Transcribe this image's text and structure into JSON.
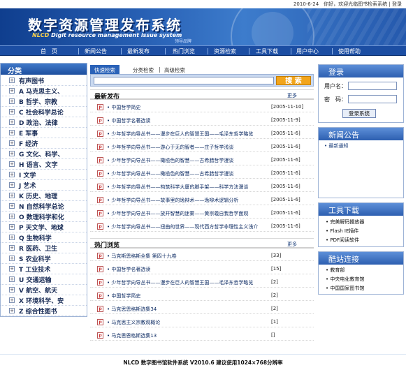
{
  "topbar": {
    "text": "2010-6-24　你好，欢迎光临图书检索系统 | 登录"
  },
  "banner": {
    "title": "数字资源管理发布系统",
    "sub_brand": "NLCD",
    "sub_text": "Digit resource management issue system",
    "small": "领导品牌"
  },
  "nav": {
    "items": [
      "首　页",
      "新闻公告",
      "最新发布",
      "热门浏览",
      "资源检索",
      "工具下载",
      "用户中心",
      "使用帮助"
    ]
  },
  "sidebar": {
    "title": "分类",
    "items": [
      "有声图书",
      "A 马克思主义、",
      "B 哲学、宗教",
      "C 社会科学总论",
      "D 政治、法律",
      "E 军事",
      "F 经济",
      "G 文化、科学、",
      "H 语言、文字",
      "I 文学",
      "J 艺术",
      "K 历史、地理",
      "N 自然科学总论",
      "O 数理科学和化",
      "P 天文学、地球",
      "Q 生物科学",
      "R 医药、卫生",
      "S 农业科学",
      "T 工业技术",
      "U 交通运输",
      "V 航空、航天",
      "X 环境科学、安",
      "Z 综合性图书"
    ]
  },
  "search": {
    "tabs": [
      "快速检索",
      "分类检索",
      "高级检索"
    ],
    "button": "搜 索",
    "value": ""
  },
  "latest": {
    "title": "最新发布",
    "more": "更多",
    "rows": [
      {
        "title": "• 中国哲学简史",
        "date": "[2005-11-10]"
      },
      {
        "title": "• 中国哲学名著选读",
        "date": "[2005-11-9]"
      },
      {
        "title": "• 少年哲学向导丛书——漫步在巨人的智慧王国——毛泽东哲学略览",
        "date": "[2005-11-6]"
      },
      {
        "title": "• 少年哲学向导丛书——游心于无的智者——庄子哲学浅谈",
        "date": "[2005-11-6]"
      },
      {
        "title": "• 少年哲学向导丛书——橄榄色的智慧——古希腊哲学漫谈",
        "date": "[2005-11-6]"
      },
      {
        "title": "• 少年哲学向导丛书——橄榄色的智慧——古希腊哲学漫谈",
        "date": "[2005-11-6]"
      },
      {
        "title": "• 少年哲学向导丛书——构筑科学大厦的脚手架——科学方法漫谈",
        "date": "[2005-11-6]"
      },
      {
        "title": "• 少年哲学向导丛书——故事里的逸辩术——逸辩术逻辑分析",
        "date": "[2005-11-6]"
      },
      {
        "title": "• 少年哲学向导丛书——放开智慧的迷雾——黄宗羲自我哲学面观",
        "date": "[2005-11-6]"
      },
      {
        "title": "• 少年哲学向导丛书——扭曲的世界——现代西方哲学非理性主义浅介",
        "date": "[2005-11-6]"
      }
    ]
  },
  "hot": {
    "title": "热门浏览",
    "more": "更多",
    "rows": [
      {
        "title": "• 马克斯恩格斯全集 第四十九卷",
        "count": "[33]"
      },
      {
        "title": "• 中国哲学名著选读",
        "count": "[15]"
      },
      {
        "title": "• 少年哲学向导丛书——漫步在巨人的智慧王国——毛泽东哲学略览",
        "count": "[2]"
      },
      {
        "title": "• 中国哲学简史",
        "count": "[2]"
      },
      {
        "title": "• 马克思恩格斯选集34",
        "count": "[2]"
      },
      {
        "title": "• 马克思主义宗教观概论",
        "count": "[1]"
      },
      {
        "title": "• 马克思恩格斯选集13",
        "count": "[]"
      }
    ]
  },
  "login": {
    "title": "登录",
    "user_label": "用户名：",
    "pass_label": "密　码：",
    "button": "登录系统"
  },
  "news": {
    "title": "新闻公告",
    "items": [
      "• 最新通知"
    ]
  },
  "tools": {
    "title": "工具下载",
    "items": [
      "• 完美解码播放器",
      "• Flash IE插件",
      "• PDF阅读软件"
    ]
  },
  "links": {
    "title": "酷站连接",
    "items": [
      "• 教育部",
      "• 中央电化教育馆",
      "• 中国国家图书馆"
    ]
  },
  "footer": {
    "text": "NLCD 数字图书馆软件系统 V2010.6 建议使用1024×768分辨率"
  }
}
